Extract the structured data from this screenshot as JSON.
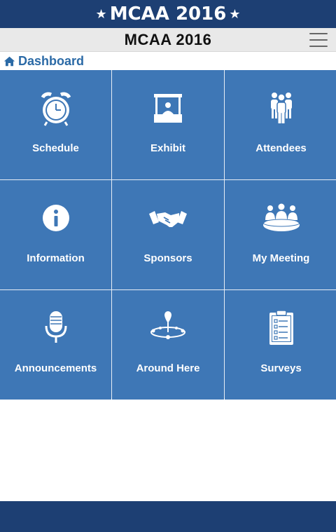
{
  "banner": {
    "title": "MCAA 2016",
    "star_glyph": "★"
  },
  "header": {
    "title": "MCAA 2016",
    "menu_icon": "hamburger-icon"
  },
  "breadcrumb": {
    "icon": "home-icon",
    "label": "Dashboard"
  },
  "tiles": [
    {
      "label": "Schedule",
      "icon": "alarm-clock-icon"
    },
    {
      "label": "Exhibit",
      "icon": "exhibit-booth-icon"
    },
    {
      "label": "Attendees",
      "icon": "attendees-icon"
    },
    {
      "label": "Information",
      "icon": "info-icon"
    },
    {
      "label": "Sponsors",
      "icon": "handshake-icon"
    },
    {
      "label": "My Meeting",
      "icon": "meeting-icon"
    },
    {
      "label": "Announcements",
      "icon": "microphone-icon"
    },
    {
      "label": "Around Here",
      "icon": "map-pin-icon"
    },
    {
      "label": "Surveys",
      "icon": "clipboard-icon"
    }
  ],
  "colors": {
    "banner": "#1d3f73",
    "tile": "#3e77b6",
    "accent_text": "#2b6aa6",
    "footer": "#1d3f73"
  }
}
